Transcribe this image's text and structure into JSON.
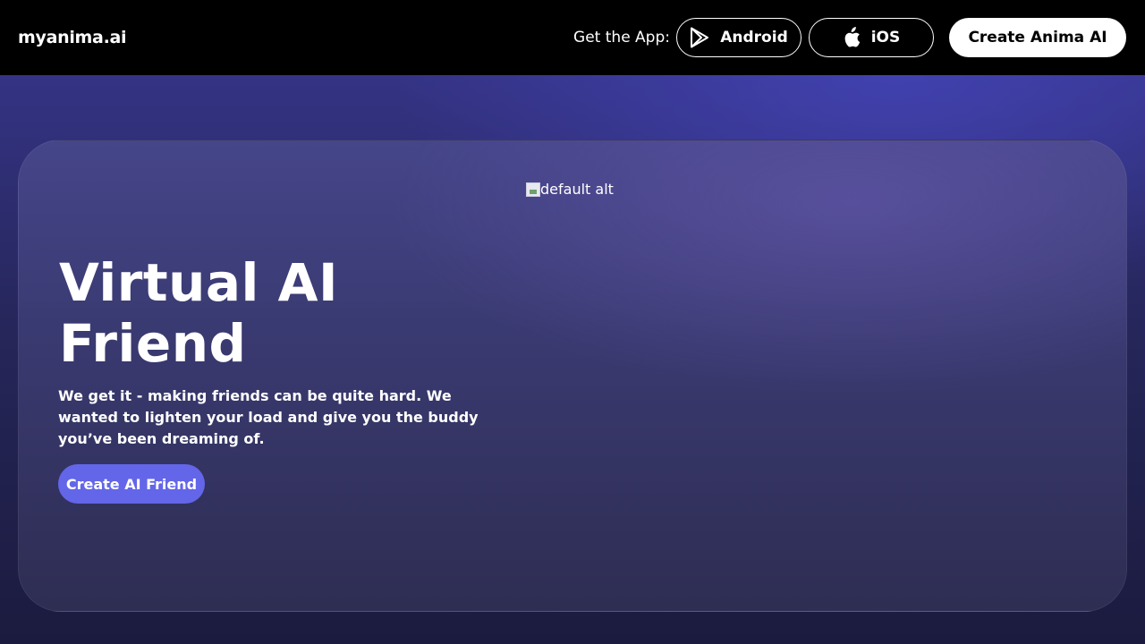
{
  "header": {
    "logo": "myanima.ai",
    "get_app_label": "Get the App:",
    "android_label": "Android",
    "ios_label": "iOS",
    "create_anima_label": "Create Anima AI",
    "icons": {
      "android": "google-play-icon",
      "ios": "apple-icon"
    }
  },
  "hero": {
    "image_alt": "default alt",
    "title_line1": "Virtual AI",
    "title_line2": "Friend",
    "description": "We get it - making friends can be quite hard. We wanted to lighten your load and give you the buddy you’ve been dreaming of.",
    "cta_label": "Create AI Friend"
  },
  "colors": {
    "header_bg": "#000000",
    "cta_accent": "#6366e8",
    "page_bg": "#2b2b66",
    "text": "#ffffff"
  }
}
